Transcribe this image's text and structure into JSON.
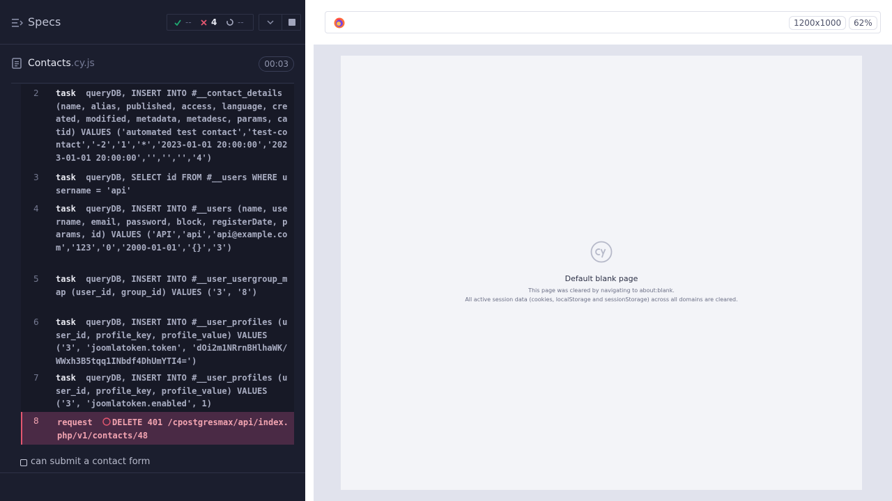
{
  "header": {
    "title": "Specs",
    "stats": {
      "passed": "--",
      "failed": "4",
      "pending": "--"
    }
  },
  "spec": {
    "name": "Contacts",
    "ext": ".cy.js",
    "duration": "00:03"
  },
  "commands": [
    {
      "num": "2",
      "name": "task",
      "message": "queryDB, INSERT INTO #__contact_details (name, alias, published, access, language, created, modified, metadata, metadesc, params, catid) VALUES ('automated test contact','test-contact','-2','1','*','2023-01-01 20:00:00','2023-01-01 20:00:00','','','','4')"
    },
    {
      "num": "3",
      "name": "task",
      "message": "queryDB, SELECT id FROM #__users WHERE username = 'api'"
    },
    {
      "num": "4",
      "name": "task",
      "message": "queryDB, INSERT INTO #__users (name, username, email, password, block, registerDate, params, id) VALUES ('API','api','api@example.com','123','0','2000-01-01','{}','3')"
    },
    {
      "num": "5",
      "name": "task",
      "message": "queryDB, INSERT INTO #__user_usergroup_map (user_id, group_id) VALUES ('3', '8')"
    },
    {
      "num": "6",
      "name": "task",
      "message": "queryDB, INSERT INTO #__user_profiles (user_id, profile_key, profile_value) VALUES ('3', 'joomlatoken.token', 'dOi2m1NRrnBHlhaWK/WWxh3B5tqq1INbdf4DhUmYTI4=')"
    },
    {
      "num": "7",
      "name": "task",
      "message": "queryDB, INSERT INTO #__user_profiles (user_id, profile_key, profile_value) VALUES ('3', 'joomlatoken.enabled', 1)"
    },
    {
      "num": "8",
      "name": "request",
      "message": "DELETE 401 /cpostgresmax/api/index.php/v1/contacts/48"
    }
  ],
  "next_test": "can submit a contact form",
  "browser": {
    "viewport_size": "1200x1000",
    "zoom": "62%"
  },
  "blank_page": {
    "title": "Default blank page",
    "line1": "This page was cleared by navigating to about:blank.",
    "line2": "All active session data (cookies, localStorage and sessionStorage) across all domains are cleared."
  },
  "colors": {
    "failed": "#e45770",
    "passed": "#1fa971",
    "panel": "#1b1e2e"
  },
  "icons": [
    "menu-icon",
    "check-icon",
    "x-icon",
    "pending-icon",
    "chevron-down-icon",
    "stop-icon",
    "file-icon",
    "spinner-icon",
    "firefox-icon",
    "cypress-logo"
  ]
}
